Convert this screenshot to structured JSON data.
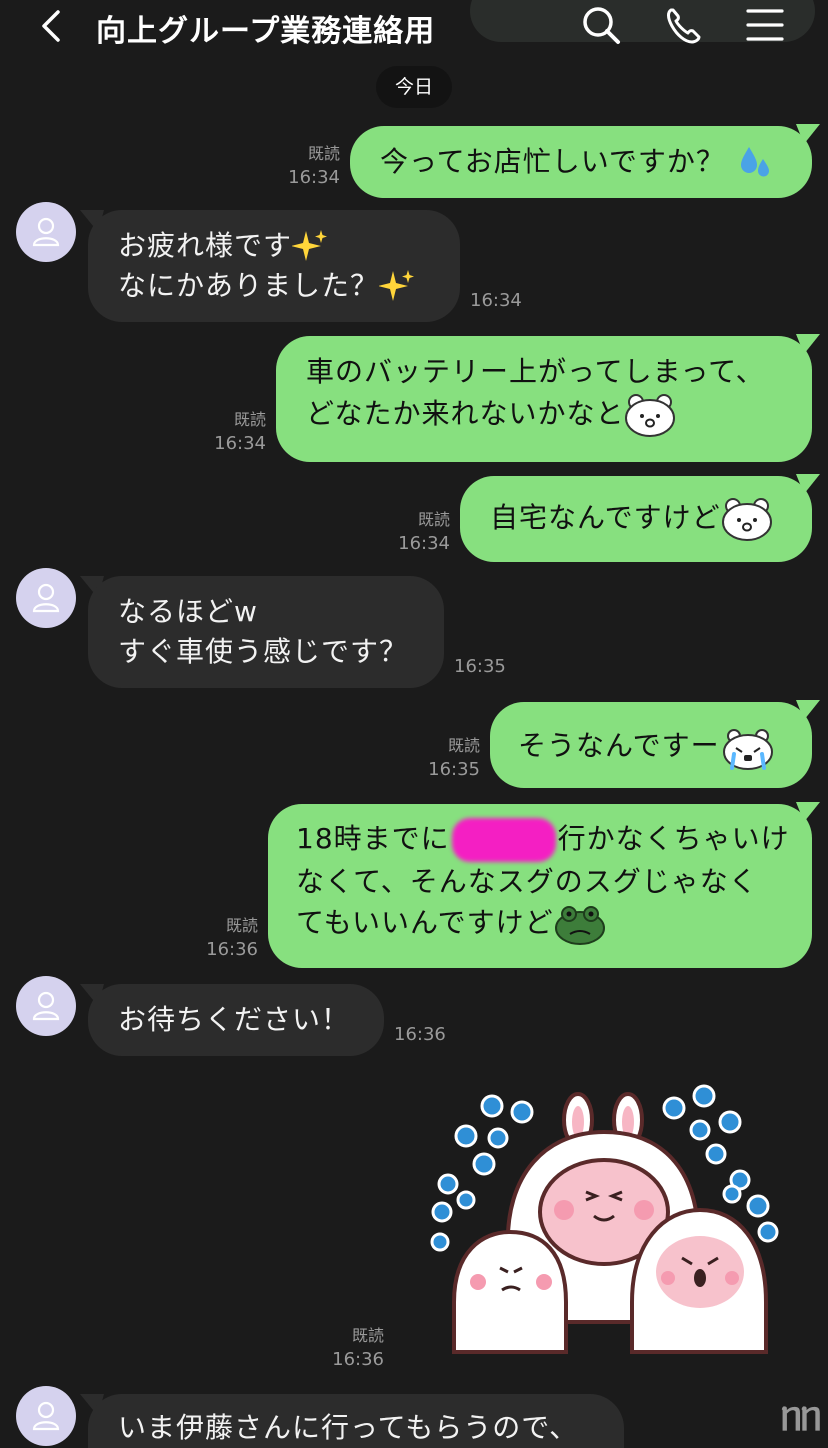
{
  "header": {
    "title": "向上グループ業務連絡用"
  },
  "date_divider": "今日",
  "messages": [
    {
      "side": "out",
      "read": "既読",
      "time": "16:34",
      "lines": [
        "今ってお店忙しいですか？"
      ]
    },
    {
      "side": "in",
      "time": "16:34",
      "lines": [
        "お疲れ様です",
        "なにかありました？"
      ]
    },
    {
      "side": "out",
      "read": "既読",
      "time": "16:34",
      "lines": [
        "車のバッテリー上がってしまって、",
        "どなたか来れないかなと"
      ]
    },
    {
      "side": "out",
      "read": "既読",
      "time": "16:34",
      "lines": [
        "自宅なんですけど"
      ]
    },
    {
      "side": "in",
      "time": "16:35",
      "lines": [
        "なるほどw",
        "すぐ車使う感じです？"
      ]
    },
    {
      "side": "out",
      "read": "既読",
      "time": "16:35",
      "lines": [
        "そうなんですー"
      ]
    },
    {
      "side": "out",
      "read": "既読",
      "time": "16:36",
      "lines": [
        "18時までに",
        "行かなくちゃいけ",
        "なくて、そんなスグのスグじゃなく",
        "てもいいんですけど"
      ]
    },
    {
      "side": "in",
      "time": "16:36",
      "lines": [
        "お待ちください！"
      ]
    },
    {
      "side": "out",
      "read": "既読",
      "time": "16:36",
      "sticker": "crying-rabbits-sticker"
    },
    {
      "side": "in",
      "lines": [
        "いま伊藤さんに行ってもらうので、"
      ]
    }
  ],
  "colors": {
    "background": "#1b1b1b",
    "outgoing_bubble": "#87e07f",
    "incoming_bubble": "#2c2c2c",
    "avatar": "#d5d2ee",
    "redaction": "#f41fc3"
  },
  "watermark": "ᥒᥒ"
}
